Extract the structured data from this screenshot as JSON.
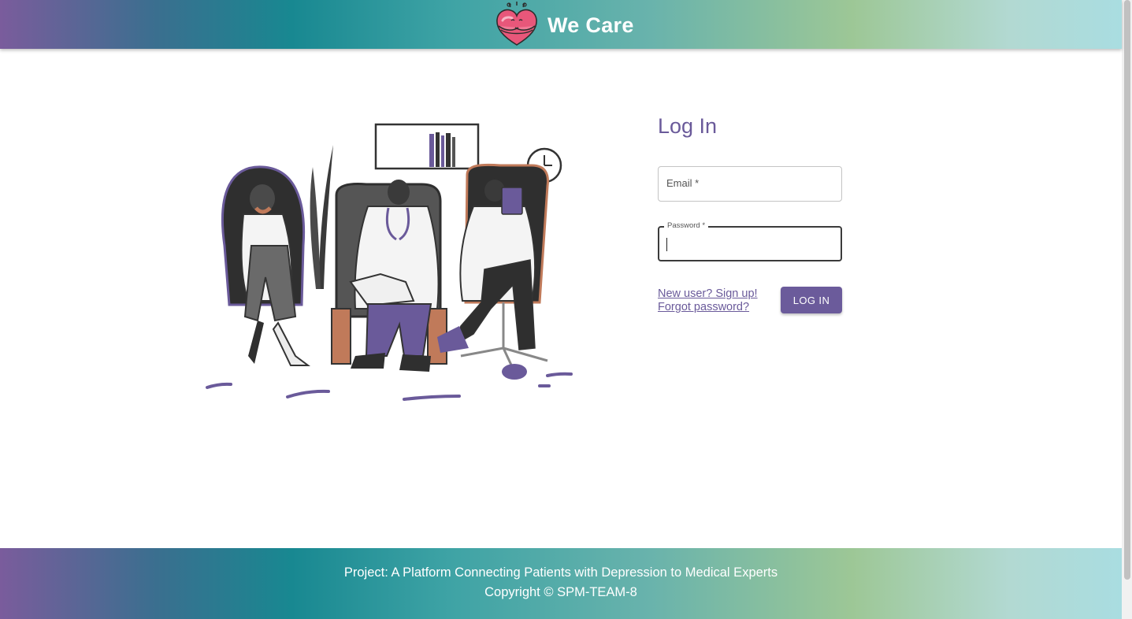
{
  "header": {
    "app_name": "We Care",
    "logo_icon": "heart-hug-icon",
    "colors": {
      "gradient_start": "#7a5c9c",
      "gradient_mid": "#188891",
      "gradient_end": "#a9dde1"
    }
  },
  "illustration": {
    "icon": "waiting-room-illustration"
  },
  "login": {
    "title": "Log In",
    "email_label": "Email *",
    "email_value": "",
    "password_label": "Password *",
    "password_value": "",
    "signup_link": "New user? Sign up!",
    "forgot_link": "Forgot password?",
    "submit_label": "LOG IN",
    "accent_color": "#6b5b9b"
  },
  "footer": {
    "line1": "Project: A Platform Connecting Patients with Depression to Medical Experts",
    "line2": "Copyright © SPM-TEAM-8"
  }
}
